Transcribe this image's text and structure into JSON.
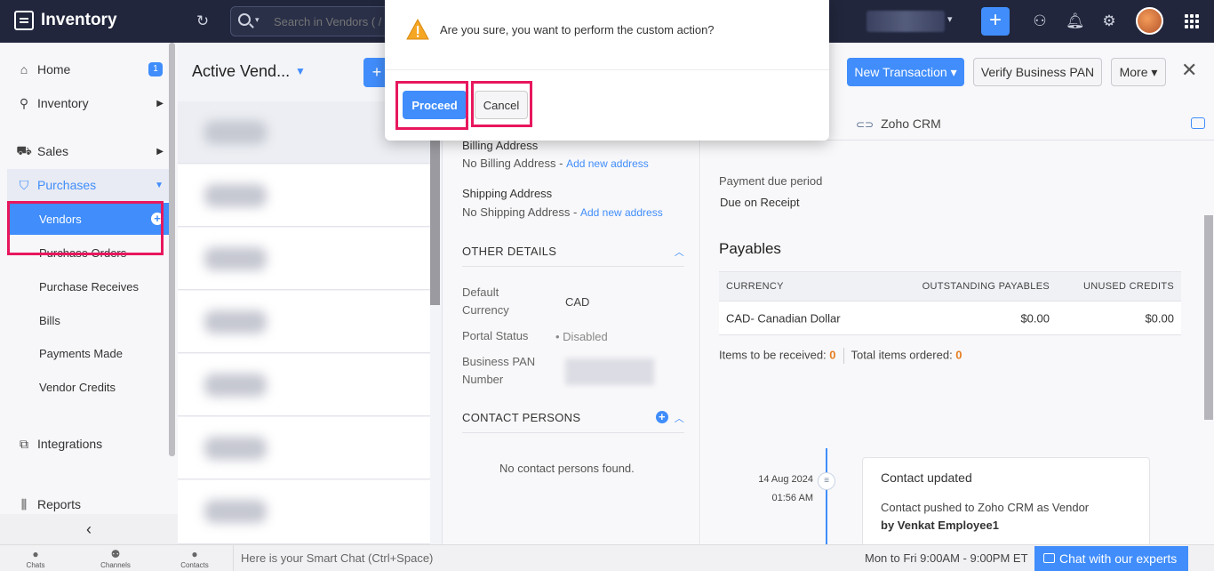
{
  "app": {
    "title": "Inventory"
  },
  "search": {
    "placeholder": "Search in Vendors ( / )"
  },
  "sidebar": {
    "home": "Home",
    "home_badge": "1",
    "inventory": "Inventory",
    "sales": "Sales",
    "purchases": "Purchases",
    "vendors": "Vendors",
    "purchase_orders": "Purchase Orders",
    "purchase_receives": "Purchase Receives",
    "bills": "Bills",
    "payments_made": "Payments Made",
    "vendor_credits": "Vendor Credits",
    "integrations": "Integrations",
    "reports": "Reports"
  },
  "list": {
    "title": "Active Vend...",
    "new_label": "+"
  },
  "details": {
    "billing_label": "Billing Address",
    "billing_value": "No Billing Address - ",
    "billing_link": "Add new address",
    "shipping_label": "Shipping Address",
    "shipping_value": "No Shipping Address - ",
    "shipping_link": "Add new address",
    "other_details": "OTHER DETAILS",
    "default_currency_key": "Default Currency",
    "default_currency_val": "CAD",
    "portal_status_key": "Portal Status",
    "portal_status_val": "• Disabled",
    "pan_key": "Business PAN Number",
    "contact_persons": "CONTACT PERSONS",
    "no_contacts": "No contact persons found."
  },
  "right": {
    "new_transaction": "New Transaction ▾",
    "verify_pan": "Verify Business PAN",
    "more": "More ▾",
    "tab_crm": "Zoho CRM",
    "payment_due_label": "Payment due period",
    "payment_due_value": "Due on Receipt",
    "payables_title": "Payables",
    "table_headers": [
      "CURRENCY",
      "OUTSTANDING PAYABLES",
      "UNUSED CREDITS"
    ],
    "table_row": [
      "CAD- Canadian Dollar",
      "$0.00",
      "$0.00"
    ],
    "items_received_label": "Items to be received: ",
    "items_received_value": "0",
    "items_ordered_label": "Total items ordered: ",
    "items_ordered_value": "0"
  },
  "timeline": {
    "date": "14 Aug 2024",
    "time": "01:56 AM",
    "title": "Contact updated",
    "desc": "Contact pushed to Zoho CRM as Vendor",
    "by": "by Venkat Employee1"
  },
  "modal": {
    "message": "Are you sure, you want to perform the custom action?",
    "proceed": "Proceed",
    "cancel": "Cancel"
  },
  "bottombar": {
    "chats": "Chats",
    "channels": "Channels",
    "contacts": "Contacts",
    "smart_chat": "Here is your Smart Chat (Ctrl+Space)",
    "hours": "Mon to Fri 9:00AM - 9:00PM ET",
    "chat_experts": "Chat with our experts"
  },
  "colors": {
    "accent": "#408dfb",
    "highlight": "#e8175d",
    "topbar": "#21263c"
  }
}
